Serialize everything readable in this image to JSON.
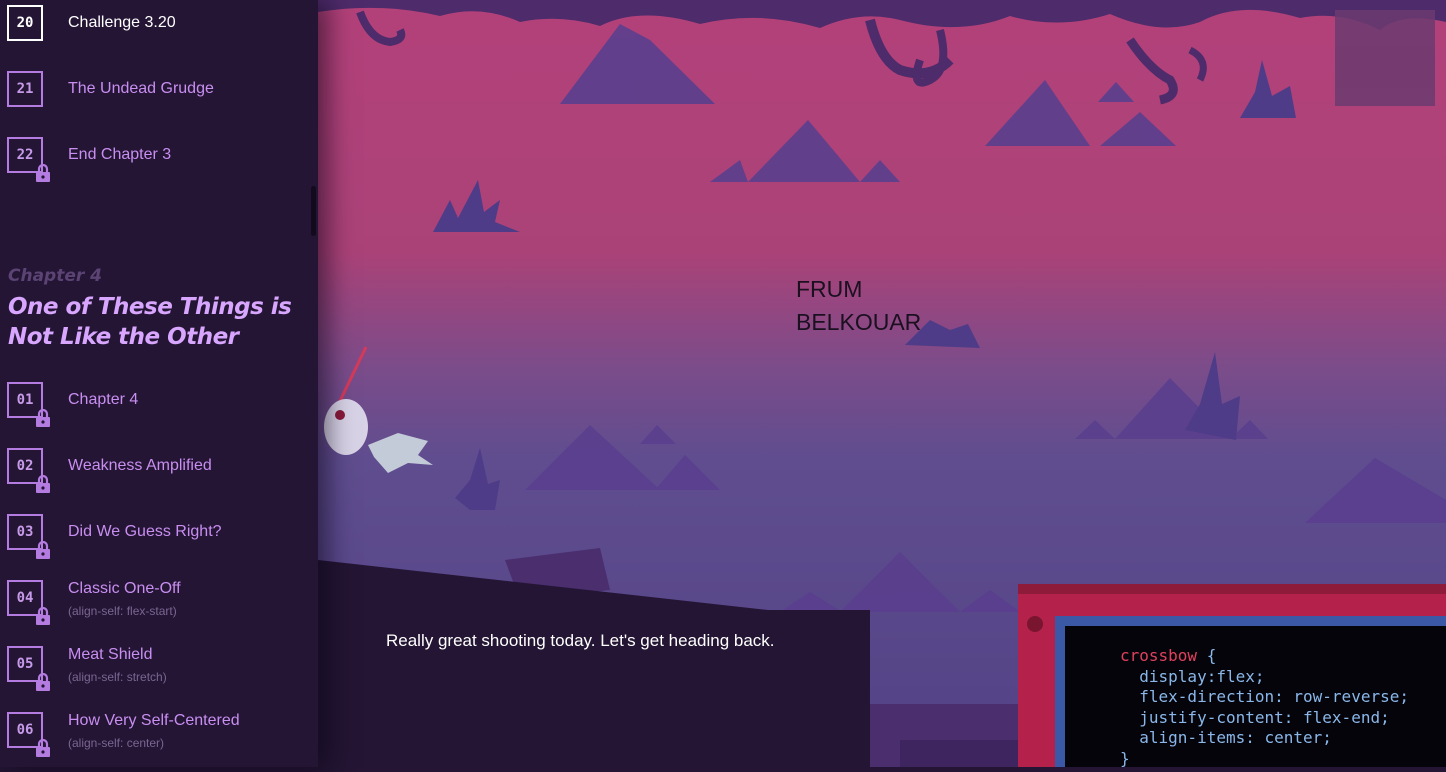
{
  "sidebar": {
    "levels_top": [
      {
        "num": "20",
        "title": "Challenge 3.20",
        "locked": false,
        "current": true
      },
      {
        "num": "21",
        "title": "The Undead Grudge",
        "locked": false,
        "current": false
      },
      {
        "num": "22",
        "title": "End Chapter 3",
        "locked": true,
        "current": false
      }
    ],
    "chapter": {
      "label": "Chapter 4",
      "title": "One of These Things is Not Like the Other"
    },
    "levels": [
      {
        "num": "01",
        "title": "Chapter 4",
        "sub": "",
        "locked": true
      },
      {
        "num": "02",
        "title": "Weakness Amplified",
        "sub": "",
        "locked": true
      },
      {
        "num": "03",
        "title": "Did We Guess Right?",
        "sub": "",
        "locked": true
      },
      {
        "num": "04",
        "title": "Classic One-Off",
        "sub": "(align-self: flex-start)",
        "locked": true
      },
      {
        "num": "05",
        "title": "Meat Shield",
        "sub": "(align-self: stretch)",
        "locked": true
      },
      {
        "num": "06",
        "title": "How Very Self-Centered",
        "sub": "(align-self: center)",
        "locked": true
      }
    ]
  },
  "overlay": {
    "line1": "FRUM",
    "line2": "BELKOUAR"
  },
  "dialog": {
    "text": "Really great shooting today. Let's get heading back."
  },
  "code": {
    "selector": "crossbow",
    "open_brace": " {",
    "lines": [
      "  display:flex;",
      "  flex-direction: row-reverse;",
      "  justify-content: flex-end;",
      "  align-items: center;"
    ],
    "close_brace": "}"
  },
  "colors": {
    "sidebar_bg": "#241535",
    "accent_purple": "#b47ce0",
    "sky_top": "#b3417a",
    "sky_bottom": "#5c4a8a",
    "code_frame": "#b4224b",
    "code_border": "#3a58a6",
    "code_selector": "#e0405f",
    "code_text": "#8ab7ea"
  }
}
